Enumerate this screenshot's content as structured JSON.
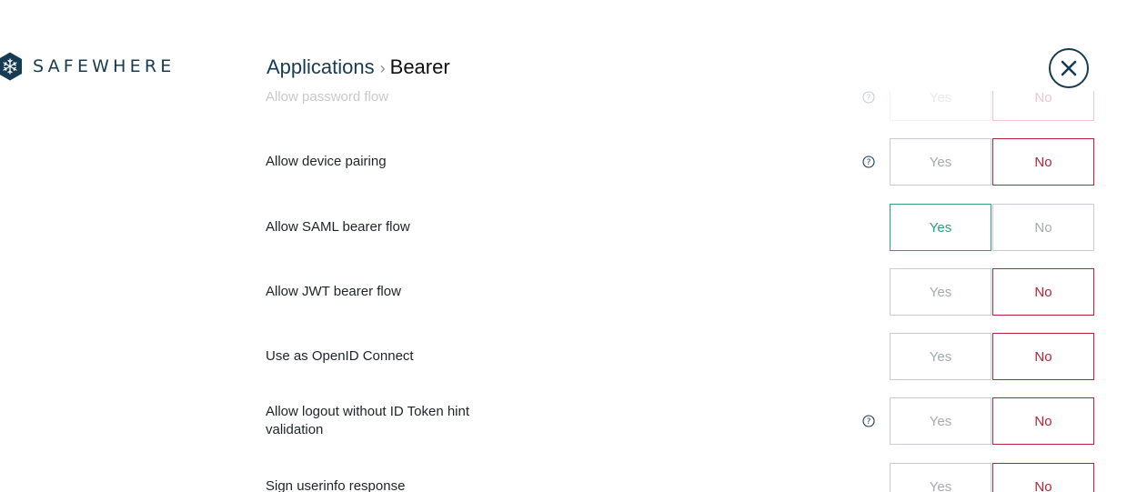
{
  "brand": {
    "name": "SAFEWHERE"
  },
  "breadcrumb": {
    "parent": "Applications",
    "separator": "›",
    "current": "Bearer"
  },
  "options": {
    "yes": "Yes",
    "no": "No"
  },
  "settings": [
    {
      "label": "Allow password flow",
      "help": true,
      "value": "No",
      "faded": true
    },
    {
      "label": "Allow device pairing",
      "help": true,
      "value": "No"
    },
    {
      "label": "Allow SAML bearer flow",
      "help": false,
      "value": "Yes"
    },
    {
      "label": "Allow JWT bearer flow",
      "help": false,
      "value": "No"
    },
    {
      "label": "Use as OpenID Connect",
      "help": false,
      "value": "No"
    },
    {
      "label": "Allow logout without ID Token hint validation",
      "help": true,
      "value": "No"
    },
    {
      "label": "Sign userinfo response",
      "help": false,
      "value": "No"
    }
  ],
  "colors": {
    "brand": "#173b52",
    "selected_no": "#b3263a",
    "selected_yes": "#2f9e7a",
    "unselected": "#c9cdd1"
  }
}
